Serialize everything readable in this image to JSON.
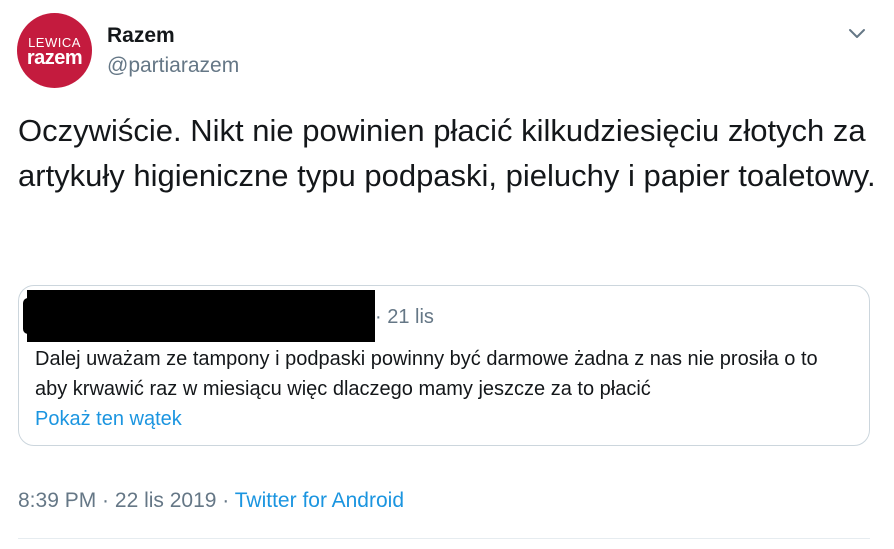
{
  "author": {
    "avatar_line1": "LEWICA",
    "avatar_line2": "razem",
    "display_name": "Razem",
    "handle": "@partiarazem"
  },
  "tweet": {
    "text": "Oczywiście. Nikt nie powinien płacić kilkudziesięciu złotych za artykuły higieniczne typu podpaski, pieluchy i papier toaletowy."
  },
  "quoted_tweet": {
    "date": "· 21 lis",
    "text": "Dalej uważam ze tampony i podpaski powinny być darmowe żadna z nas nie prosiła o to aby krwawić raz w miesiącu więc dlaczego mamy jeszcze za to płacić",
    "show_thread_label": "Pokaż ten wątek"
  },
  "meta": {
    "time": "8:39 PM",
    "separator1": " · ",
    "date": "22 lis 2019",
    "separator2": " · ",
    "app": "Twitter for Android"
  },
  "icons": {
    "caret": "chevron-down-icon"
  },
  "colors": {
    "avatar_bg": "#c41b3e",
    "link": "#1b95e0",
    "secondary_text": "#657786",
    "border": "#ccd6dd"
  }
}
